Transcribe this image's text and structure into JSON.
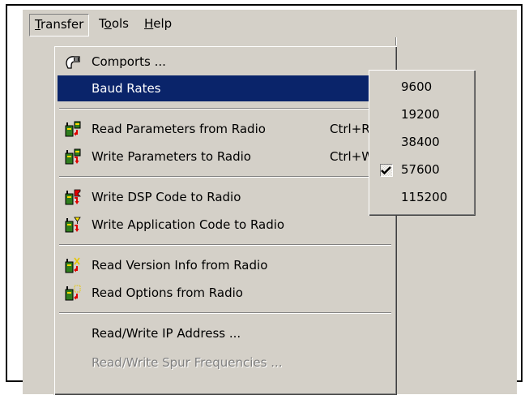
{
  "menubar": {
    "items": [
      {
        "pre": "",
        "key": "T",
        "post": "ransfer"
      },
      {
        "pre": "T",
        "key": "o",
        "post": "ols"
      },
      {
        "pre": "",
        "key": "H",
        "post": "elp"
      }
    ]
  },
  "menu": {
    "items": [
      {
        "label": "Comports ...",
        "icon": "comport-icon"
      },
      {
        "label": "Baud Rates",
        "icon": "",
        "submenu": true
      },
      {
        "label": "Read Parameters from Radio",
        "shortcut": "Ctrl+R",
        "icon": "radio-read-icon"
      },
      {
        "label": "Write Parameters to Radio",
        "shortcut": "Ctrl+W",
        "icon": "radio-write-icon"
      },
      {
        "label": "Write DSP Code to Radio",
        "icon": "radio-dsp-icon"
      },
      {
        "label": "Write Application Code to Radio",
        "icon": "radio-app-icon"
      },
      {
        "label": "Read Version Info from Radio",
        "icon": "radio-version-icon"
      },
      {
        "label": "Read Options from Radio",
        "icon": "radio-options-icon"
      },
      {
        "label": "Read/Write IP Address ...",
        "icon": ""
      },
      {
        "label": "Read/Write Spur Frequencies ...",
        "icon": "",
        "disabled": true
      }
    ]
  },
  "submenu": {
    "items": [
      {
        "label": "9600",
        "checked": false
      },
      {
        "label": "19200",
        "checked": false
      },
      {
        "label": "38400",
        "checked": false
      },
      {
        "label": "57600",
        "checked": true
      },
      {
        "label": "115200",
        "checked": false
      }
    ]
  },
  "colors": {
    "menu_bg": "#d4d0c8",
    "highlight": "#0a246a",
    "disabled_text": "#808080"
  }
}
